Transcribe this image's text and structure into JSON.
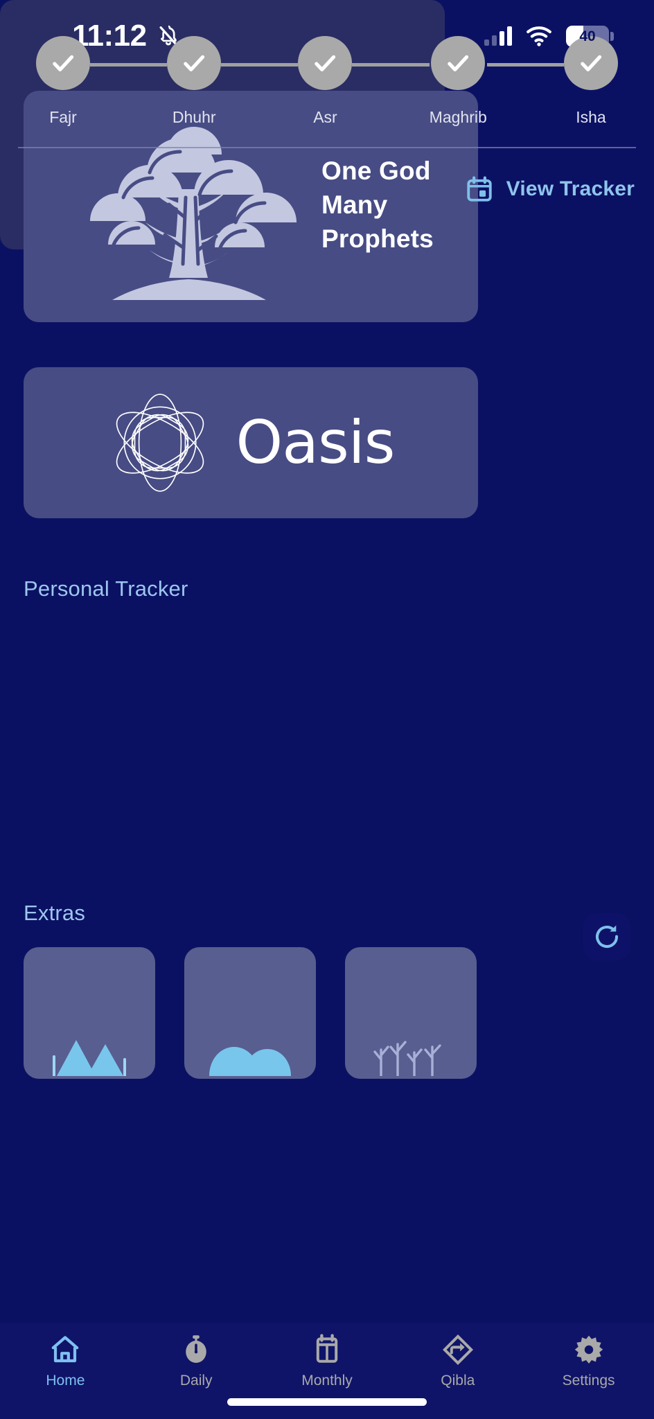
{
  "status_bar": {
    "time": "11:12",
    "silent_icon": "bell-slash-icon",
    "signal_icon": "cellular-signal-icon",
    "wifi_icon": "wifi-icon",
    "battery_level": "40"
  },
  "hero": {
    "icon": "tree-icon",
    "line1": "One God",
    "line2": "Many",
    "line3": "Prophets"
  },
  "brand": {
    "logo_icon": "oasis-mandala-icon",
    "name": "Oasis"
  },
  "tracker": {
    "title": "Personal Tracker",
    "prayers": [
      {
        "label": "Fajr",
        "completed": true
      },
      {
        "label": "Dhuhr",
        "completed": true
      },
      {
        "label": "Asr",
        "completed": true
      },
      {
        "label": "Maghrib",
        "completed": true
      },
      {
        "label": "Isha",
        "completed": true
      }
    ],
    "view_link": {
      "icon": "calendar-icon",
      "label": "View Tracker"
    }
  },
  "extras": {
    "title": "Extras",
    "cards": [
      {
        "icon": "mountains-icon"
      },
      {
        "icon": "hills-icon"
      },
      {
        "icon": "coral-icon"
      }
    ]
  },
  "refresh": {
    "icon": "refresh-icon"
  },
  "bottom_nav": {
    "items": [
      {
        "label": "Home",
        "icon": "home-icon",
        "active": true
      },
      {
        "label": "Daily",
        "icon": "stopwatch-icon",
        "active": false
      },
      {
        "label": "Monthly",
        "icon": "calendar-month-icon",
        "active": false
      },
      {
        "label": "Qibla",
        "icon": "qibla-direction-icon",
        "active": false
      },
      {
        "label": "Settings",
        "icon": "gear-icon",
        "active": false
      }
    ]
  },
  "colors": {
    "page_background": "#0b1162",
    "card_background": "#474c84",
    "tracker_background": "#2a2d63",
    "accent_blue": "#8fc4ec",
    "heading_blue": "#9dc6ef",
    "prayer_circle": "#a9a9a9",
    "nav_inactive": "#a9a9a9",
    "nav_active": "#7fc0f0",
    "text_white": "#ffffff"
  }
}
